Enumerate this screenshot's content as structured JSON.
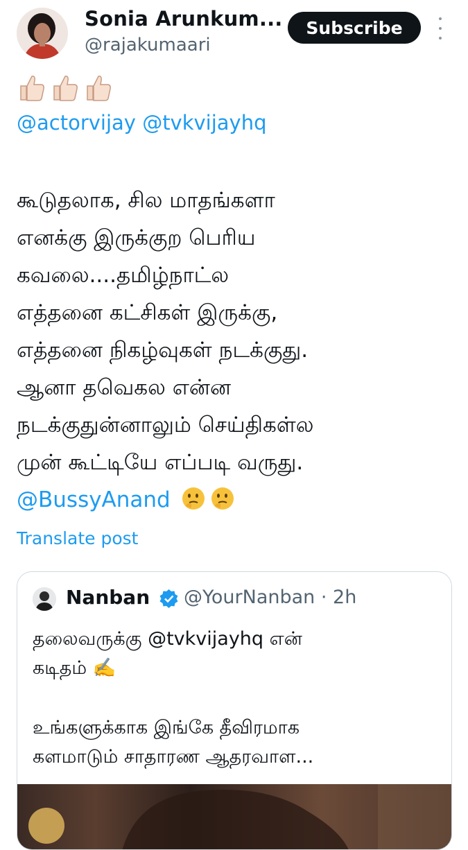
{
  "author": {
    "name": "Sonia Arunkum...",
    "handle": "@rajakumaari",
    "avatar_icon": "profile-photo"
  },
  "actions": {
    "subscribe_label": "Subscribe",
    "more_icon": "more-vertical-icon"
  },
  "post": {
    "emoji_row": "👍🏻👍🏻👍🏻",
    "mentions": [
      "@actorvijay",
      "@tvkvijayhq"
    ],
    "lines": [
      "கூடுதலாக, சில மாதங்களா",
      "எனக்கு இருக்குற பெரிய",
      "கவலை....தமிழ்நாட்ல",
      "எத்தனை கட்சிகள் இருக்கு,",
      "எத்தனை நிகழ்வுகள் நடக்குது.",
      "ஆனா தவெகல என்ன",
      "நடக்குதுன்னாலும் செய்திகள்ல",
      "முன் கூட்டியே எப்படி வருது."
    ],
    "last_mention": "@BussyAnand",
    "last_emoji": "🤔🤔",
    "translate_label": "Translate post"
  },
  "quoted": {
    "name": "Nanban",
    "verified_icon": "verified-badge-icon",
    "handle": "@YourNanban",
    "time": "· 2h",
    "line1": "தலைவருக்கு @tvkvijayhq என்",
    "line2": "கடிதம் ✍️",
    "line3": "உங்களுக்காக இங்கே தீவிரமாக",
    "line4": "களமாடும் சாதாரண ஆதரவாள..."
  },
  "colors": {
    "link": "#1d9bf0",
    "secondary": "#536471",
    "border": "#cfd9de",
    "button": "#0f1419"
  }
}
